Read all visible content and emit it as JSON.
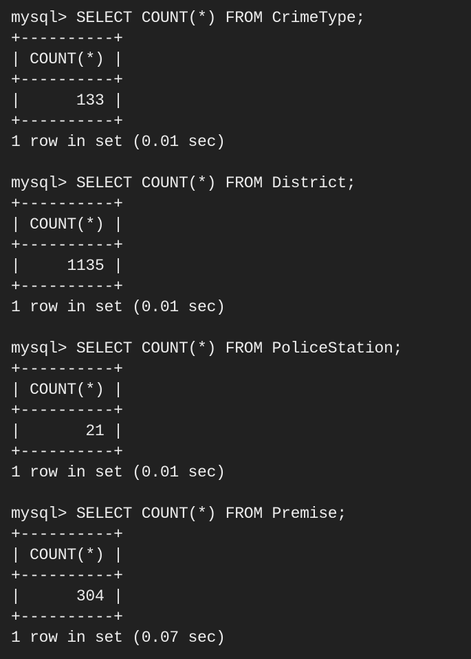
{
  "terminal": {
    "blocks": [
      {
        "prompt": "mysql> SELECT COUNT(*) FROM CrimeType;",
        "border": "+----------+",
        "header": "| COUNT(*) |",
        "value": "|      133 |",
        "result": "1 row in set (0.01 sec)"
      },
      {
        "prompt": "mysql> SELECT COUNT(*) FROM District;",
        "border": "+----------+",
        "header": "| COUNT(*) |",
        "value": "|     1135 |",
        "result": "1 row in set (0.01 sec)"
      },
      {
        "prompt": "mysql> SELECT COUNT(*) FROM PoliceStation;",
        "border": "+----------+",
        "header": "| COUNT(*) |",
        "value": "|       21 |",
        "result": "1 row in set (0.01 sec)"
      },
      {
        "prompt": "mysql> SELECT COUNT(*) FROM Premise;",
        "border": "+----------+",
        "header": "| COUNT(*) |",
        "value": "|      304 |",
        "result": "1 row in set (0.07 sec)"
      }
    ]
  }
}
